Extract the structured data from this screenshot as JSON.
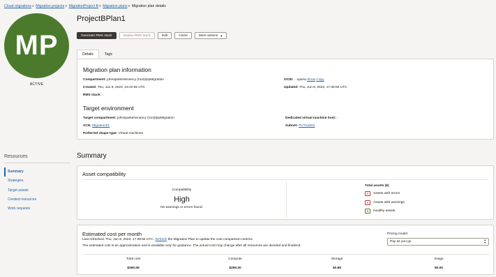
{
  "breadcrumb": {
    "items": [
      "Cloud migrations",
      "Migration projects",
      "MigrationProject B",
      "Migration plans"
    ],
    "current": "Migration plan details"
  },
  "avatar": {
    "initials": "MP",
    "status": "ACTIVE",
    "color": "#4c7a2d"
  },
  "page_title": "ProjectBPlan1",
  "actions": {
    "generate": "Generate RMS stack",
    "deploy": "Deploy RMS stack",
    "edit": "Edit",
    "clone": "Clone",
    "more": "More actions"
  },
  "tabs": [
    "Details",
    "Tags"
  ],
  "plan_info": {
    "title": "Migration plan information",
    "compartment_label": "Compartment:",
    "compartment_value": "johnsparkertenancy (root)/jspMigration",
    "created_label": "Created:",
    "created_value": "Thu, Jun 8, 2023, 16:22:55 UTC",
    "rms_label": "RMS stack:",
    "rms_value": "-",
    "ocid_label": "OCID:",
    "ocid_value": "...vpxira",
    "ocid_show": "Show",
    "ocid_copy": "Copy",
    "updated_label": "Updated:",
    "updated_value": "Thu, Jun 8, 2023, 17:39:56 UTC"
  },
  "target_env": {
    "title": "Target environment",
    "compartment_label": "Target compartment:",
    "compartment_value": "johnsparkertenancy (root)/jspMigration",
    "vcn_label": "VCN:",
    "vcn_value": "Migration01",
    "shape_label": "Preferred shape type:",
    "shape_value": "Virtual machines",
    "dvmh_label": "Dedicated virtual machine host:",
    "dvmh_value": "-",
    "subnet_label": "Subnet:",
    "subnet_value": "PVTSub01"
  },
  "resources": {
    "title": "Resources",
    "items": [
      "Summary",
      "Strategies",
      "Target assets",
      "Created resources",
      "Work requests"
    ]
  },
  "summary": {
    "title": "Summary",
    "compat": {
      "title": "Asset compatibility",
      "compat_label": "Compatibility",
      "compat_value": "High",
      "compat_note": "No warnings or errors found.",
      "total_label": "Total assets (6)",
      "errors_count": "0",
      "errors_label": "Assets with errors",
      "warnings_count": "0",
      "warnings_label": "Assets with warnings",
      "healthy_count": "6",
      "healthy_label": "Healthy assets"
    },
    "cost": {
      "title": "Estimated cost per month",
      "refreshed_prefix": "Last refreshed: Thu, Jun 8, 2023, 17:39:55 UTC.",
      "refresh_link": "Refresh",
      "refreshed_suffix": "the Migration Plan to update the cost comparison metrics.",
      "note": "The estimated cost is an approximation and is available only for guidance. The actual cost may change after all resources are decided and finalized.",
      "pricing_label": "Pricing model",
      "pricing_value": "Pay as you go",
      "columns": [
        {
          "label": "Total cost",
          "value": "$260.05"
        },
        {
          "label": "Compute",
          "value": "$259.20"
        },
        {
          "label": "Storage",
          "value": "$0.85"
        },
        {
          "label": "Image",
          "value": "$0.00"
        }
      ]
    }
  }
}
